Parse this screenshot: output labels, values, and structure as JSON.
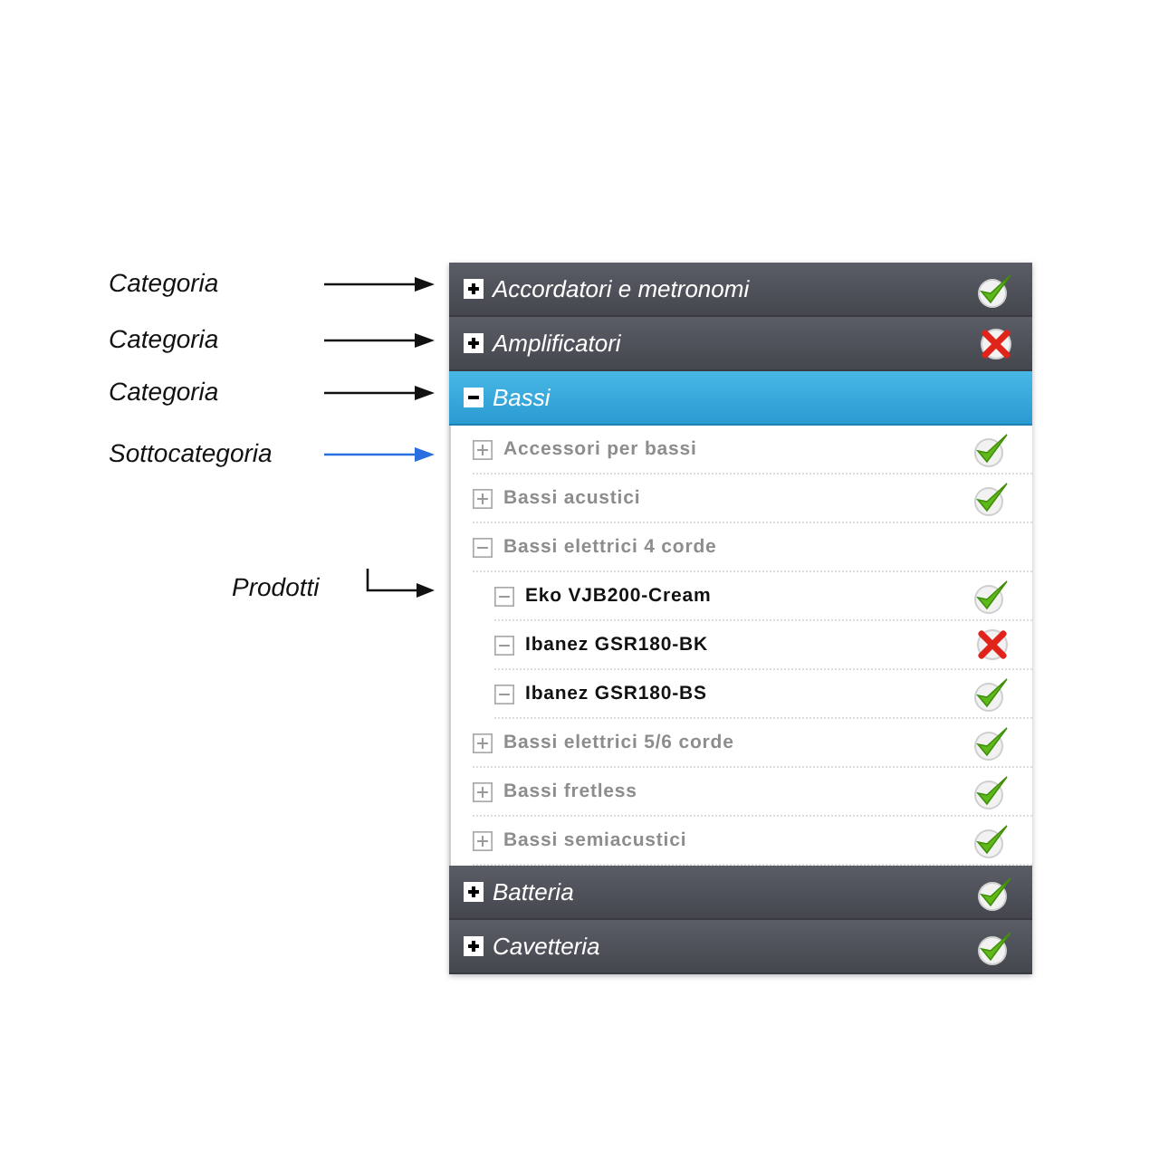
{
  "annotations": [
    {
      "text": "Categoria",
      "kind": "straight",
      "color": "#111111"
    },
    {
      "text": "Categoria",
      "kind": "straight",
      "color": "#111111"
    },
    {
      "text": "Categoria",
      "kind": "straight",
      "color": "#111111"
    },
    {
      "text": "Sottocategoria",
      "kind": "straight",
      "color": "#2a6fe0"
    },
    {
      "text": "Prodotti",
      "kind": "elbow",
      "color": "#111111"
    }
  ],
  "categories": [
    {
      "label": "Accordatori e metronomi",
      "expanded": false,
      "selected": false,
      "approved": true
    },
    {
      "label": "Amplificatori",
      "expanded": false,
      "selected": false,
      "approved": false
    },
    {
      "label": "Bassi",
      "expanded": true,
      "selected": true,
      "children": [
        {
          "label": "Accessori per bassi",
          "expanded": false,
          "approved": true
        },
        {
          "label": "Bassi acustici",
          "expanded": false,
          "approved": true
        },
        {
          "label": "Bassi elettrici 4 corde",
          "expanded": true,
          "children": [
            {
              "label": "Eko VJB200-Cream",
              "approved": true
            },
            {
              "label": "Ibanez GSR180-BK",
              "approved": false
            },
            {
              "label": "Ibanez GSR180-BS",
              "approved": true
            }
          ]
        },
        {
          "label": "Bassi elettrici 5/6 corde",
          "expanded": false,
          "approved": true
        },
        {
          "label": "Bassi fretless",
          "expanded": false,
          "approved": true
        },
        {
          "label": "Bassi semiacustici",
          "expanded": false,
          "approved": true
        }
      ]
    },
    {
      "label": "Batteria",
      "expanded": false,
      "selected": false,
      "approved": true
    },
    {
      "label": "Cavetteria",
      "expanded": false,
      "selected": false,
      "approved": true
    }
  ]
}
